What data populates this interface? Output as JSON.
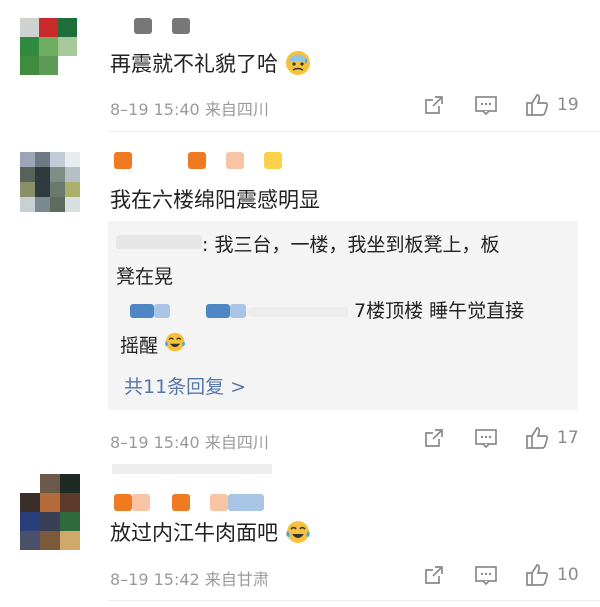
{
  "comments": [
    {
      "text": "再震就不礼貌了哈",
      "emoji": "sweat-face",
      "timestamp": "8–19 15:40",
      "location": "来自四川",
      "likes": "19"
    },
    {
      "text": "我在六楼绵阳震感明显",
      "timestamp": "8–19 15:40",
      "location": "来自四川",
      "likes": "17",
      "replies": [
        {
          "separator": ":",
          "text_line1": "我三台，一楼，我坐到板凳上，板",
          "text_line2": "凳在晃"
        },
        {
          "text_line1": "7楼顶楼 睡午觉直接",
          "text_line2": "摇醒",
          "emoji": "laugh-cry-face"
        }
      ],
      "replies_link": "共11条回复 >"
    },
    {
      "text": "放过内江牛肉面吧",
      "emoji": "laugh-cry-face",
      "timestamp": "8–19 15:42",
      "location": "来自甘肃",
      "likes": "10"
    }
  ],
  "colors": {
    "text": "#222222",
    "meta": "#9a9a9a",
    "link": "#5577aa",
    "panel": "#f4f4f4"
  }
}
